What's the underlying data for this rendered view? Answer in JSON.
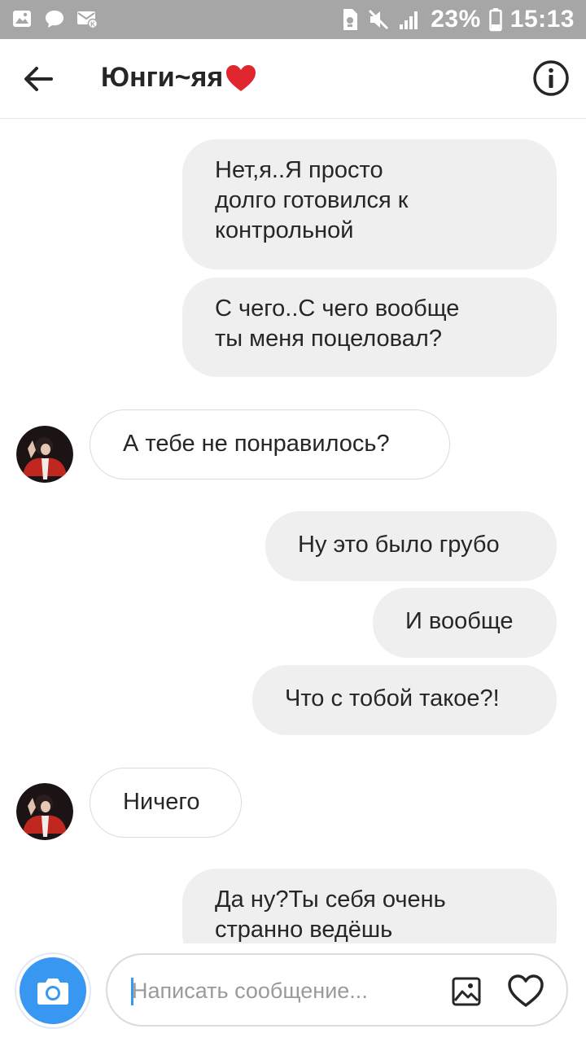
{
  "status_bar": {
    "battery": "23%",
    "time": "15:13",
    "icons": [
      "image-icon",
      "chat-icon",
      "mail-icon",
      "sim-icon",
      "mute-icon",
      "signal-icon",
      "battery-icon"
    ]
  },
  "header": {
    "title": "Юнги~яя",
    "title_emoji": "heart-emoji",
    "back_icon": "arrow-left-icon",
    "info_icon": "info-icon"
  },
  "messages": [
    {
      "side": "out",
      "lines": [
        "Нет,я..Я просто",
        "долго готовился к",
        "контрольной"
      ]
    },
    {
      "side": "out",
      "lines": [
        "С чего..С чего вообще",
        "ты меня поцеловал?"
      ]
    },
    {
      "side": "in",
      "lines": [
        "А тебе не понравилось?"
      ]
    },
    {
      "side": "out",
      "lines": [
        "Ну это было грубо"
      ]
    },
    {
      "side": "out",
      "lines": [
        "И вообще"
      ]
    },
    {
      "side": "out",
      "lines": [
        "Что с тобой такое?!"
      ]
    },
    {
      "side": "in",
      "lines": [
        "Ничего"
      ]
    },
    {
      "side": "out",
      "lines": [
        "Да ну?Ты себя очень",
        "странно ведёшь"
      ]
    }
  ],
  "composer": {
    "placeholder": "Написать сообщение...",
    "value": "",
    "camera_icon": "camera-icon",
    "gallery_icon": "gallery-icon",
    "like_icon": "heart-icon"
  },
  "colors": {
    "accent": "#3897f0",
    "out_bubble": "#efeff0",
    "in_border": "#dbdbdb",
    "status_bar": "#a6a6a6",
    "heart": "#e0262f"
  }
}
